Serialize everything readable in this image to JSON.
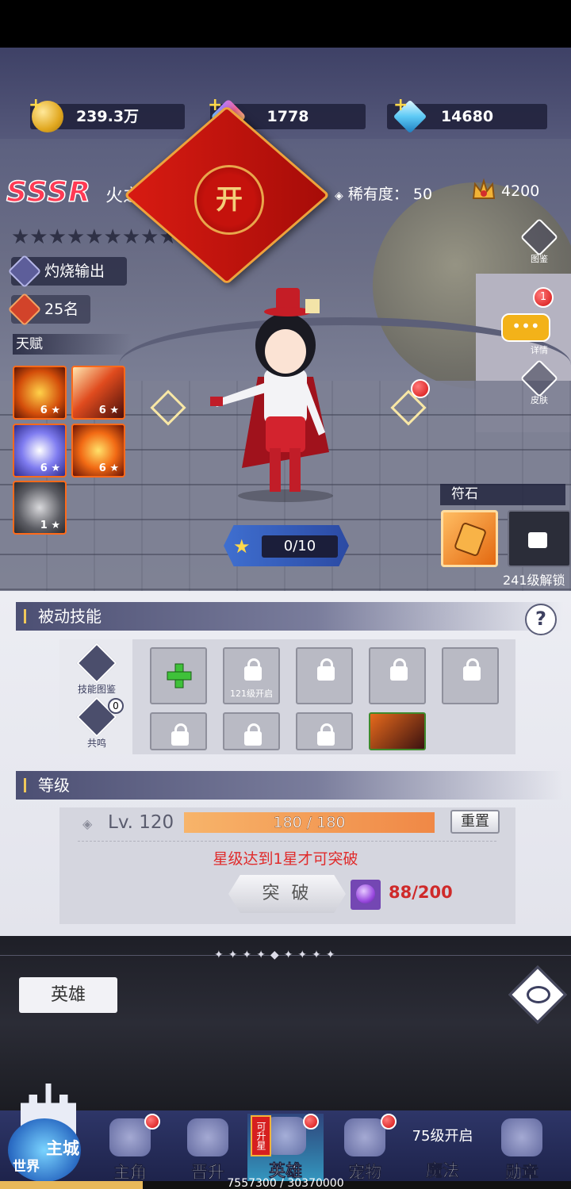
{
  "currency": [
    {
      "value": "239.3万",
      "icon": "gold-coin-icon"
    },
    {
      "value": "1778",
      "icon": "rainbow-gem-icon"
    },
    {
      "value": "14680",
      "icon": "diamond-icon"
    }
  ],
  "hero": {
    "rank": "SSSR",
    "name": "火之",
    "rarity_label": "稀有度：",
    "rarity_value": "50",
    "power": "4200",
    "role": "灼烧输出",
    "ranking": "25名",
    "talent_title": "天赋",
    "talent_skills": [
      {
        "level": "6",
        "icon": "fireball-icon"
      },
      {
        "level": "6",
        "icon": "fire-meteor-icon"
      },
      {
        "level": "6",
        "icon": "wave-icon"
      },
      {
        "level": "6",
        "icon": "phoenix-icon"
      },
      {
        "level": "1",
        "icon": "hat-icon"
      }
    ]
  },
  "red_packet": {
    "seal_text": "开"
  },
  "side_buttons": [
    {
      "label": "图鉴"
    },
    {
      "label": "详情",
      "badge": "1"
    },
    {
      "label": "皮肤"
    }
  ],
  "stamina": {
    "value": "0/10"
  },
  "rune": {
    "title": "符石",
    "unlock_text": "241级解锁"
  },
  "passive": {
    "title": "被动技能",
    "help": "?",
    "side_items": [
      {
        "label": "技能图鉴"
      },
      {
        "label": "共鸣",
        "badge": "0"
      }
    ],
    "slot_caption": "121级开启"
  },
  "level": {
    "title": "等级",
    "lv": "Lv. 120",
    "exp": "180 / 180",
    "exp_fraction": 1.0,
    "reset": "重置",
    "warning": "星级达到1星才可突破",
    "break_label": "突 破",
    "material": "88/200"
  },
  "bottom": {
    "hero_tab": "英雄"
  },
  "nav": {
    "world_top": "主城",
    "world_bottom": "世界",
    "items": [
      {
        "label": "主角",
        "dot": true
      },
      {
        "label": "晋升",
        "dot": false
      },
      {
        "label": "英雄",
        "dot": true,
        "badge": "可升星",
        "active": true
      },
      {
        "label": "宠物",
        "dot": true
      },
      {
        "label": "魔法",
        "top_text": "75级开启"
      },
      {
        "label": "勋章"
      }
    ],
    "exp_text": "7557300 / 30370000"
  },
  "colors": {
    "accent_red": "#e02b2b",
    "sssr": "#ff3a54",
    "nav_bg": "#2e3668",
    "panel_head": "#4c4f73"
  }
}
